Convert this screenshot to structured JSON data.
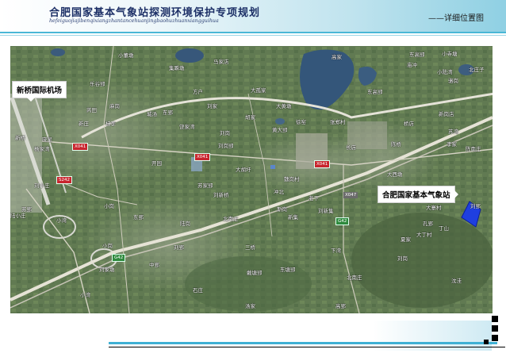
{
  "header": {
    "title": "合肥国家基本气象站探测环境保护专项规划",
    "pinyin": "hefeiguojiajibenqixiangzhantancehuanjingbaohuzhuanxiangguihua",
    "section": "——详细位置图"
  },
  "colors": {
    "accent": "#3fb0d4",
    "title": "#1c2f66",
    "station_marker": "#1f3fe0"
  },
  "callouts": {
    "airport": "新桥国际机场",
    "station": "合肥国家基本气象站"
  },
  "road_shields": [
    "X041",
    "X041",
    "X041",
    "S242",
    "G42",
    "G42",
    "X047"
  ],
  "place_labels": [
    "小董墩",
    "集瞬墩",
    "大孤家",
    "马家店",
    "方户",
    "高家",
    "庙冲",
    "东高郢",
    "小寺塘",
    "骆岗",
    "小陆湾",
    "北庄子",
    "乐谷郢",
    "麻岗",
    "芮田",
    "大黄墩",
    "东高郢",
    "桂李",
    "新庄",
    "城汤",
    "东郢",
    "刘家",
    "饶家湾",
    "新岗店",
    "杨家湾",
    "胡家",
    "刘岗",
    "张郑村",
    "长店",
    "桥店",
    "陈桥",
    "李家",
    "陈南庄",
    "黄大郢",
    "徐窑",
    "苏湾",
    "新桥",
    "晓星",
    "刘岗郢",
    "刘小庄",
    "大西墩",
    "开园",
    "大胡圩",
    "苏家郢",
    "刘新桥",
    "魏岗村",
    "大寨村",
    "丁山",
    "刘郢",
    "刘新集",
    "陆小庄",
    "苏郢",
    "小岗",
    "东郢",
    "小湾",
    "陆岗",
    "北南庄",
    "老下",
    "斯岗",
    "孔郢",
    "大丁村",
    "夏家",
    "小岗",
    "刘郢",
    "冲北",
    "新集",
    "下湾",
    "三桥",
    "刘家墩",
    "刘岗",
    "沈洼",
    "东塘郢",
    "北南庄",
    "小湾",
    "石庄",
    "汤家",
    "高郢",
    "中郢",
    "戴塘郢"
  ]
}
